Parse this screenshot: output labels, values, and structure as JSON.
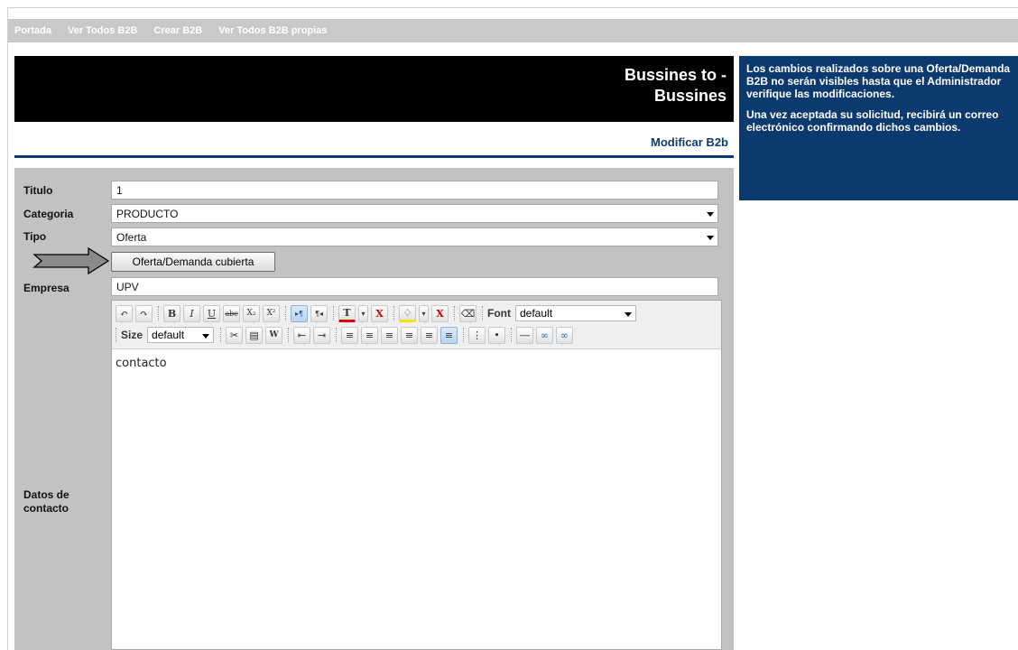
{
  "nav": {
    "items": [
      "Portada",
      "Ver Todos B2B",
      "Crear B2B",
      "Ver Todos B2B propias"
    ]
  },
  "banner": {
    "title_line1": "Bussines to -",
    "title_line2": "Bussines"
  },
  "page": {
    "subtitle": "Modificar B2b"
  },
  "info": {
    "paragraph1": "Los cambios realizados sobre una Oferta/Demanda B2B no serán visibles hasta que el Administrador verifique las modificaciones.",
    "paragraph2": "Una vez aceptada su solicitud, recibirá un correo electrónico confirmando dichos cambios."
  },
  "form": {
    "titulo_label": "Titulo",
    "titulo_value": "1",
    "categoria_label": "Categoria",
    "categoria_value": "PRODUCTO",
    "tipo_label": "Tipo",
    "tipo_value": "Oferta",
    "cubierta_button": "Oferta/Demanda cubierta",
    "empresa_label": "Empresa",
    "empresa_value": "UPV",
    "contacto_label_line1": "Datos de",
    "contacto_label_line2": "contacto",
    "contacto_value": "contacto"
  },
  "editor": {
    "font_label": "Font",
    "font_value": "default",
    "size_label": "Size",
    "size_value": "default",
    "buttons": {
      "undo": "↶",
      "redo": "↷",
      "bold": "B",
      "italic": "I",
      "underline": "U",
      "strike": "abc",
      "subscript": "X₂",
      "superscript": "X²",
      "ltr": "▸¶",
      "rtl": "¶◂",
      "text_color": "T",
      "remove_color": "X",
      "bg_color": "♢",
      "remove_bg": "X",
      "eraser": "⌫",
      "cut": "✂",
      "paste": "▤",
      "paste_word": "W",
      "outdent": "⇤",
      "indent": "⇥",
      "align_left": "≡",
      "align_center": "≡",
      "align_right": "≡",
      "justify": "≡",
      "justify_full": "≡",
      "ordered_list": "⋮",
      "unordered_list": "•",
      "hr": "―",
      "link": "∞",
      "unlink": "∞"
    }
  },
  "colors": {
    "nav_bg": "#c9c9c9",
    "accent_blue": "#0d3a6e",
    "panel_gray": "#c2c2c2",
    "banner_black": "#000000",
    "text_color_bar": "#e00000",
    "bg_color_bar": "#f5e600"
  }
}
